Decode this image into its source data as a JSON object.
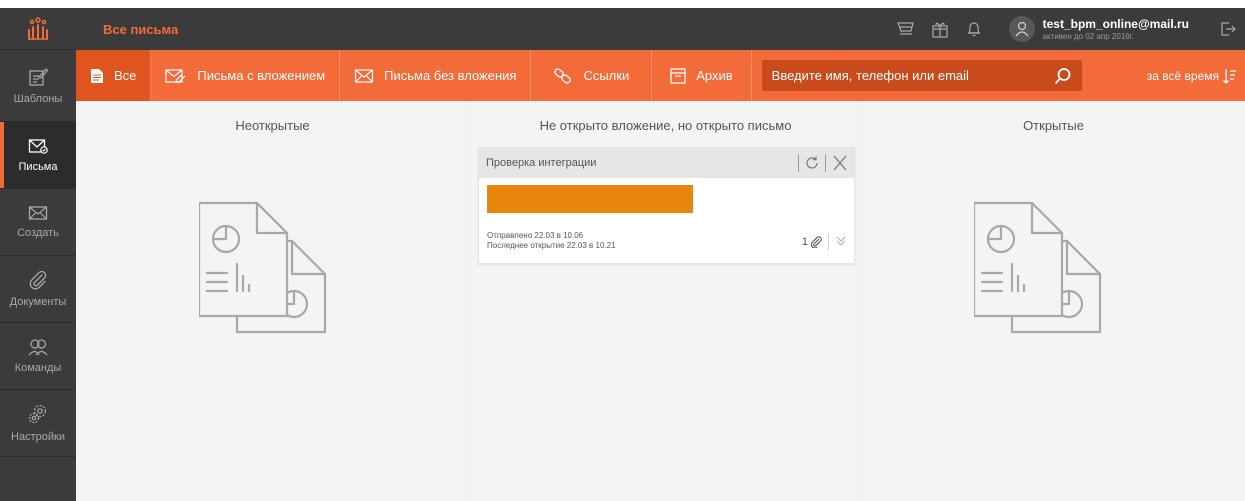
{
  "header": {
    "page_title": "Все письма",
    "user_email": "test_bpm_online@mail.ru",
    "user_status": "активен до 02 апр 2019г."
  },
  "sidebar": {
    "items": [
      {
        "label": "Шаблоны",
        "icon": "template-edit-icon"
      },
      {
        "label": "Письма",
        "icon": "letters-icon",
        "active": true
      },
      {
        "label": "Создать",
        "icon": "envelope-icon"
      },
      {
        "label": "Документы",
        "icon": "paperclip-icon"
      },
      {
        "label": "Команды",
        "icon": "team-icon"
      },
      {
        "label": "Настройки",
        "icon": "gear-icon"
      }
    ]
  },
  "filters": {
    "tabs": [
      {
        "label": "Все",
        "icon": "document-icon",
        "active": true
      },
      {
        "label": "Письма с вложением",
        "icon": "envelope-attachment-icon"
      },
      {
        "label": "Письма без вложения",
        "icon": "envelope-icon"
      },
      {
        "label": "Ссылки",
        "icon": "link-icon"
      },
      {
        "label": "Архив",
        "icon": "archive-icon"
      }
    ],
    "search_placeholder": "Введите имя, телефон или email",
    "period_label": "за всё время"
  },
  "columns": [
    {
      "title": "Неоткрытые"
    },
    {
      "title": "Не открыто вложение, но открыто письмо"
    },
    {
      "title": "Открытые"
    }
  ],
  "card": {
    "title": "Проверка интеграции",
    "sent": "Отправлено 22.03 в 10.06",
    "last_open": "Последнее открытие 22.03 в 10.21",
    "attachments_count": "1"
  },
  "colors": {
    "accent": "#f26b38",
    "accent_dark": "#e0551f",
    "dark_bg": "#3b3b3b",
    "card_bar": "#e8860b",
    "content_bg": "#f4f4f4"
  }
}
